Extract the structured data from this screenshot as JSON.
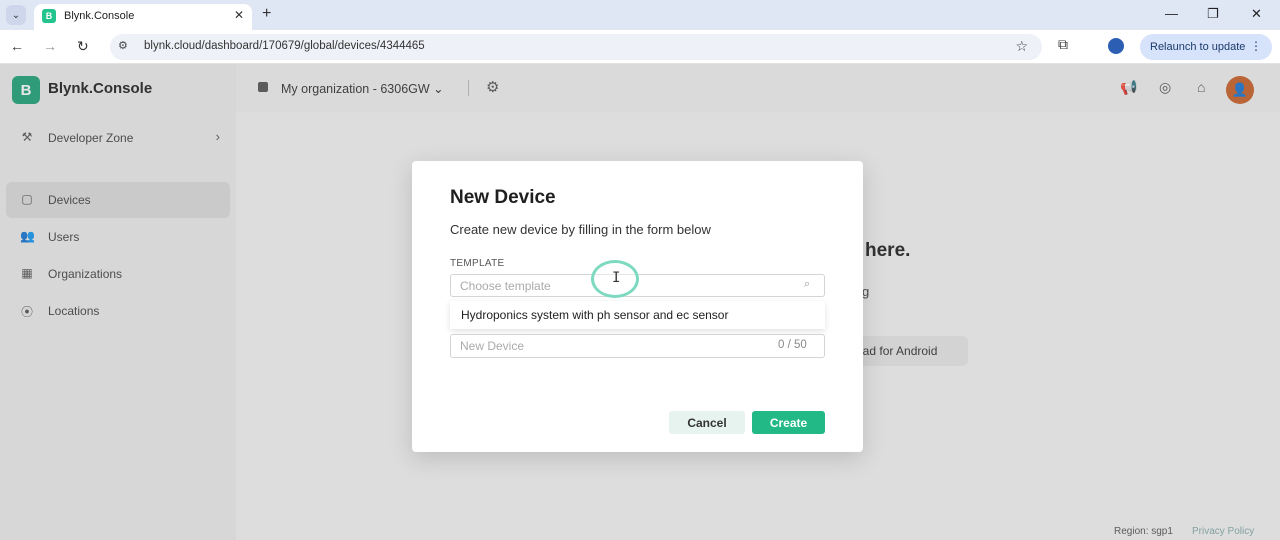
{
  "browser": {
    "tab_title": "Blynk.Console",
    "tab_favicon_letter": "B",
    "url": "blynk.cloud/dashboard/170679/global/devices/4344465",
    "relaunch_label": "Relaunch to update",
    "icons": {
      "tab_list": "chevron-down-icon",
      "close_tab": "close-icon",
      "new_tab": "plus-icon",
      "back": "arrow-left-icon",
      "forward": "arrow-right-icon",
      "reload": "reload-icon",
      "site_info": "tune-icon",
      "bookmark": "star-icon",
      "extensions": "puzzle-icon",
      "profile": "person-icon",
      "menu": "more-vert-icon",
      "minimize": "minimize-icon",
      "restore": "restore-icon",
      "close_window": "close-icon"
    }
  },
  "app": {
    "logo_letter": "B",
    "brand": "Blynk.Console",
    "org_name": "My organization - 6306GW",
    "sidebar": [
      {
        "label": "Developer Zone",
        "icon": "developer-icon",
        "has_chevron": true
      },
      {
        "label": "Devices",
        "icon": "cube-icon",
        "active": true
      },
      {
        "label": "Users",
        "icon": "users-icon"
      },
      {
        "label": "Organizations",
        "icon": "building-icon"
      },
      {
        "label": "Locations",
        "icon": "location-pin-icon"
      }
    ],
    "topbar_icons": [
      "megaphone-icon",
      "help-icon",
      "gift-icon",
      "avatar"
    ],
    "background": {
      "heading_fragment": "here.",
      "sub_fragment": "g",
      "android_fragment": "oad for Android"
    },
    "footer": {
      "region": "Region: sgp1",
      "privacy": "Privacy Policy"
    }
  },
  "modal": {
    "title": "New Device",
    "subtitle": "Create new device by filling in the form below",
    "template_label": "TEMPLATE",
    "template_placeholder": "Choose template",
    "template_options": [
      "Hydroponics system with ph sensor and ec sensor"
    ],
    "name_placeholder": "New Device",
    "name_counter": "0 / 50",
    "cancel_label": "Cancel",
    "create_label": "Create"
  },
  "colors": {
    "brand": "#1fa378",
    "primary_button": "#23b987",
    "cursor_ring": "#7dd9c0"
  }
}
